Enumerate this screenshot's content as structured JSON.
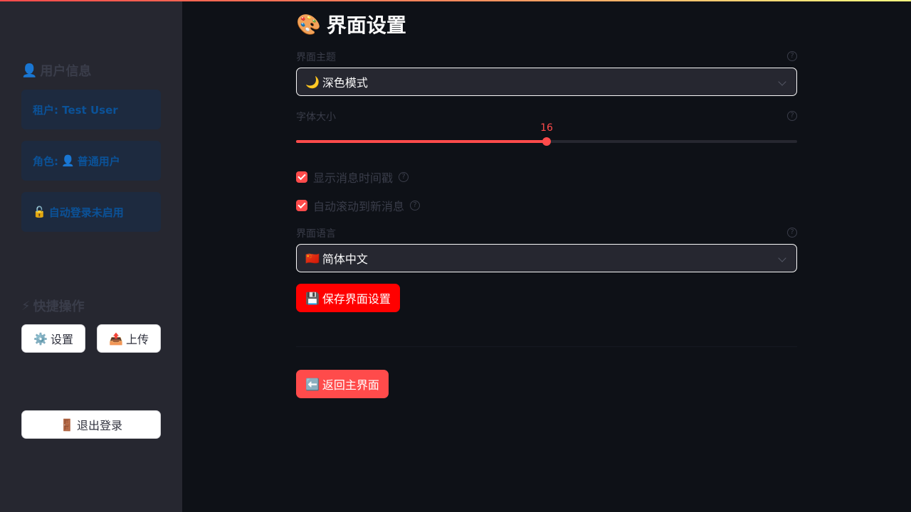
{
  "sidebar": {
    "user_section": {
      "icon": "👤",
      "title": "用户信息"
    },
    "user_line": "租户: Test User",
    "role": {
      "prefix": "角色:",
      "icon": "👤",
      "value": "普通用户"
    },
    "auto_login": {
      "icon": "🔓",
      "text": "自动登录未启用"
    },
    "quick_section": {
      "icon": "⚡",
      "title": "快捷操作"
    },
    "settings_button": {
      "icon": "⚙️",
      "label": "设置"
    },
    "upload_button": {
      "icon": "📤",
      "label": "上传"
    },
    "logout_button": {
      "icon": "🚪",
      "label": "退出登录"
    }
  },
  "main": {
    "title": {
      "icon": "🎨",
      "text": "界面设置"
    },
    "theme": {
      "label": "界面主题",
      "icon": "🌙",
      "value": "深色模式"
    },
    "font_size": {
      "label": "字体大小",
      "value": 16,
      "min": 8,
      "max": 24,
      "fraction": 0.5
    },
    "show_timestamp": {
      "label": "显示消息时间戳",
      "checked": true
    },
    "auto_scroll": {
      "label": "自动滚动到新消息",
      "checked": true
    },
    "language": {
      "label": "界面语言",
      "icon": "🇨🇳",
      "value": "简体中文"
    },
    "save_button": {
      "icon": "💾",
      "label": "保存界面设置"
    },
    "back_button": {
      "icon": "⬅️",
      "label": "返回主界面"
    },
    "help_glyph": "?"
  },
  "colors": {
    "accent": "#ff4b4b",
    "save_button_bg": "#ff0000",
    "back_button_bg": "#ff4b4b",
    "info_box_bg": "#1d2a3f",
    "info_box_text": "#0b5298"
  }
}
